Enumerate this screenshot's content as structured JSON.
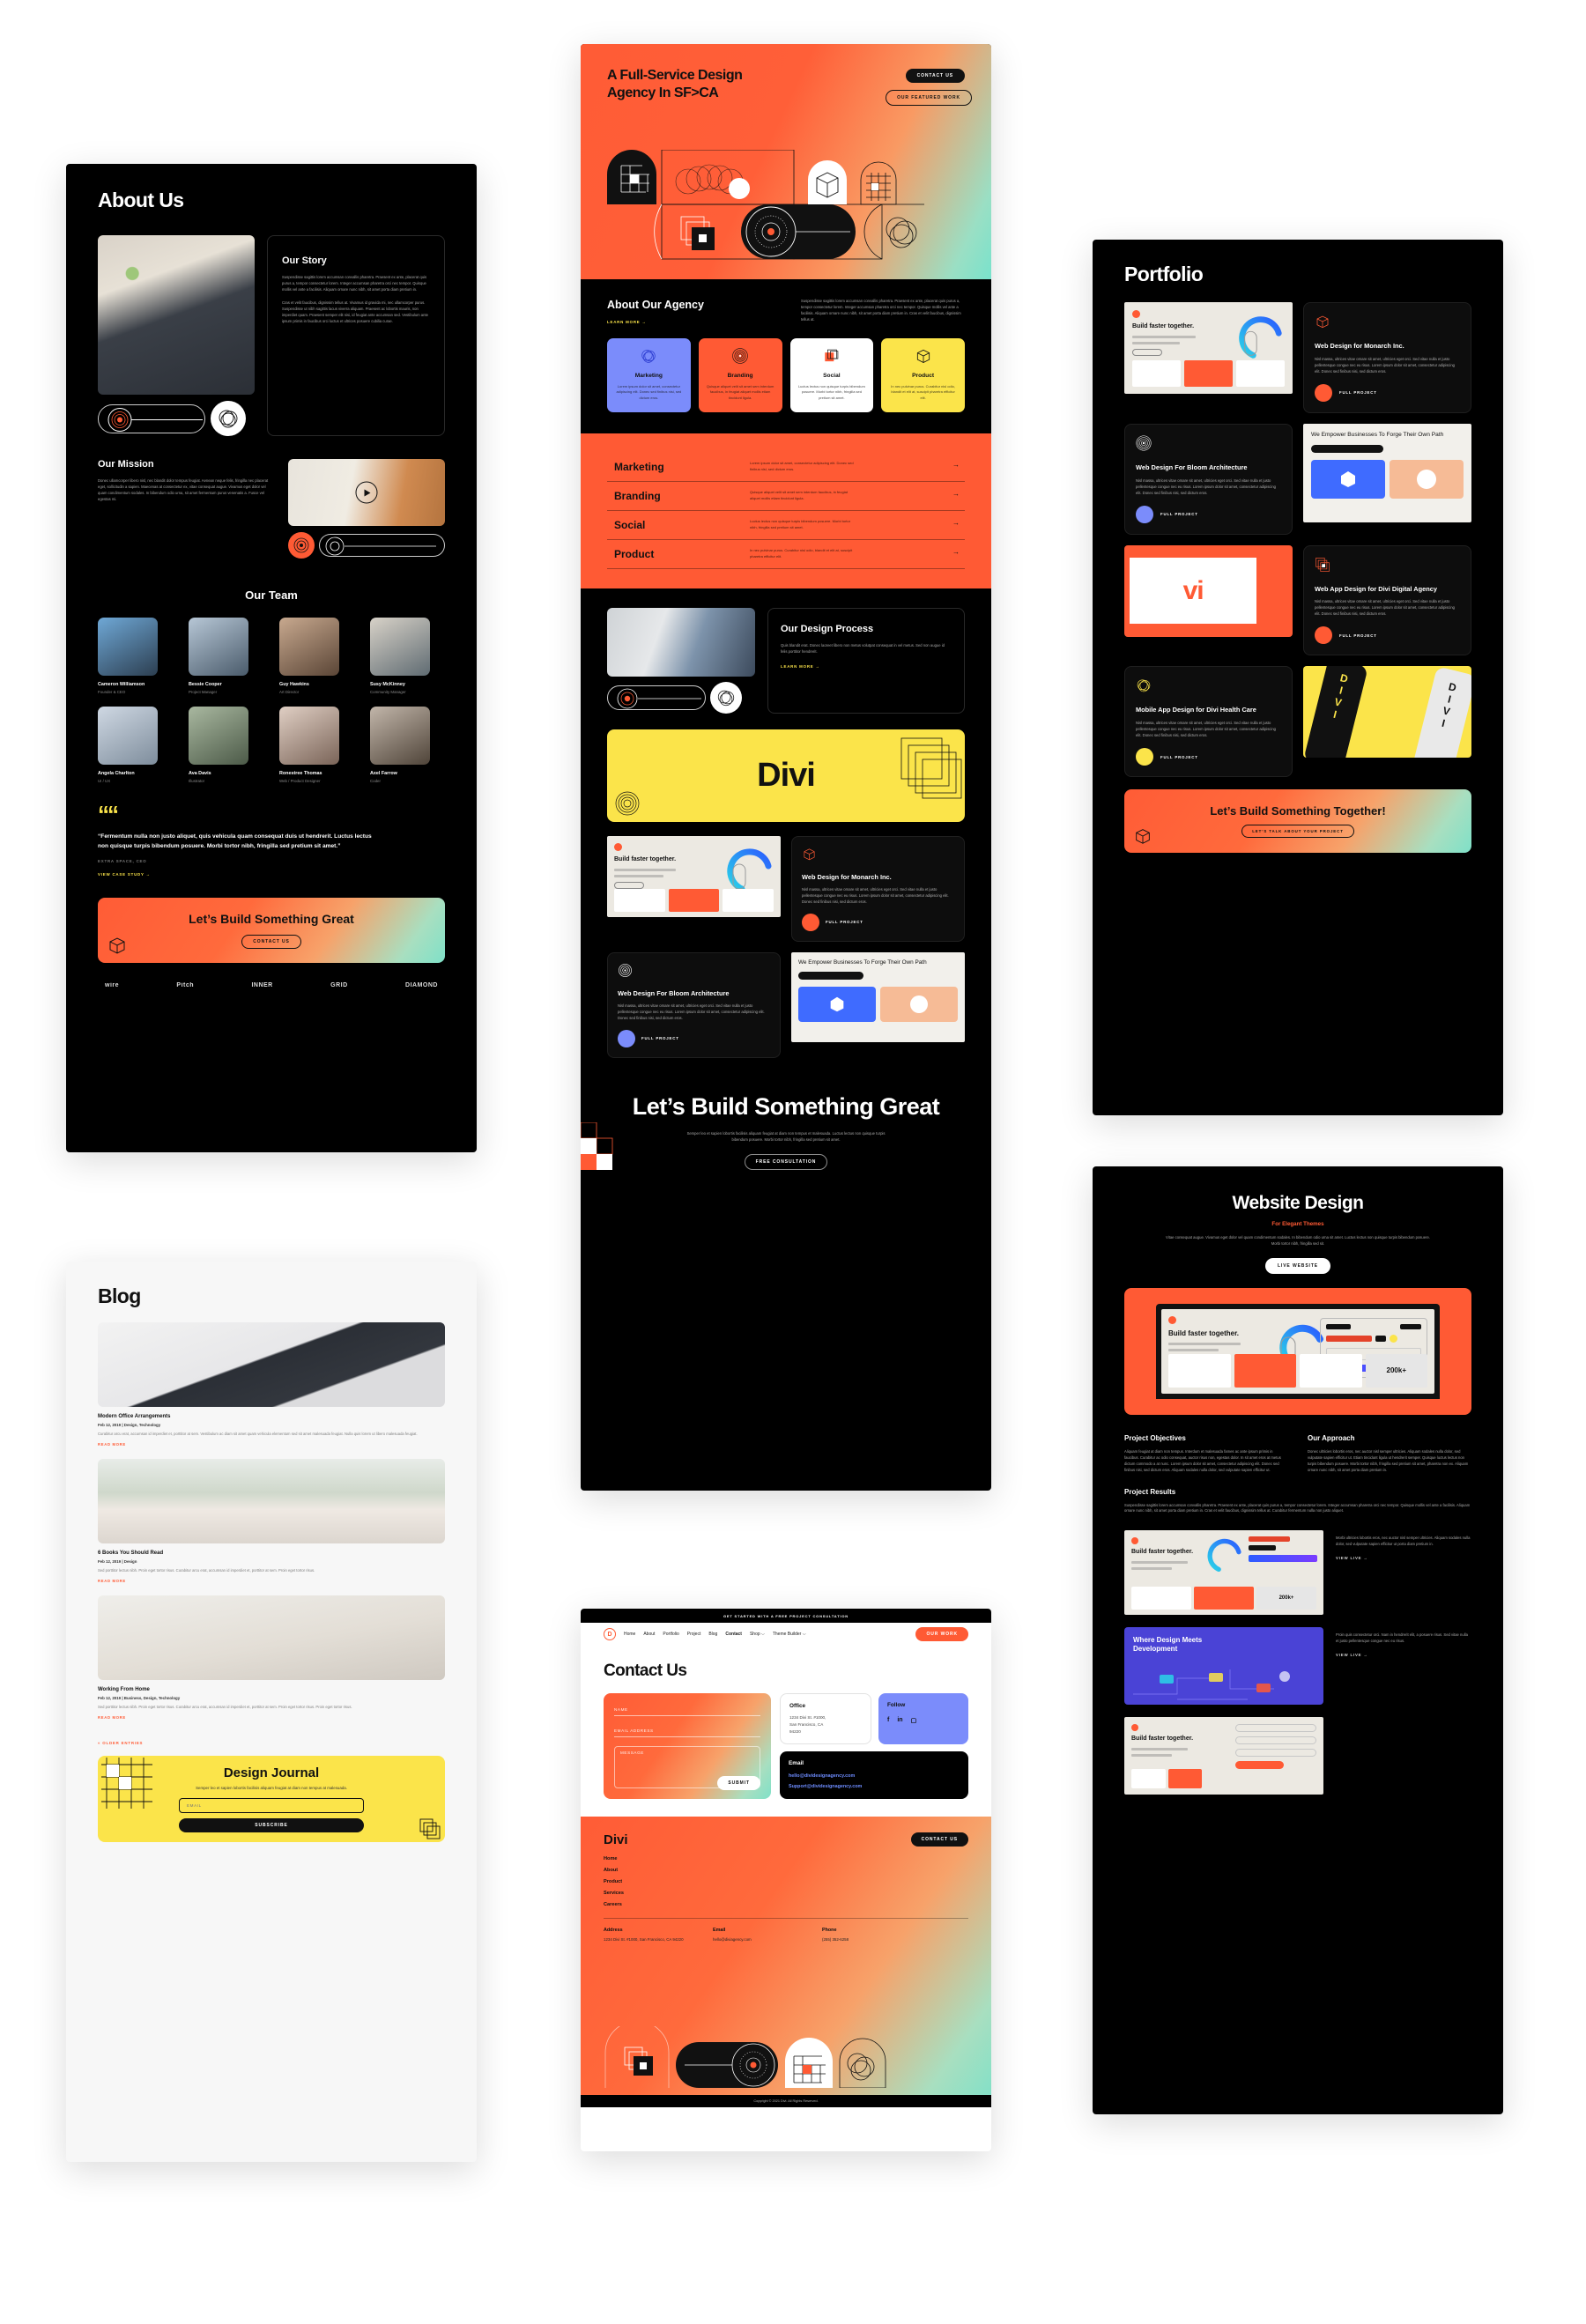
{
  "meta": {
    "accent_orange": "#ff5a34",
    "accent_yellow": "#fbe44a",
    "accent_blue": "#7b8cfb",
    "dark": "#000000"
  },
  "about": {
    "title": "About Us",
    "story": {
      "heading": "Our Story",
      "p1": "Suspendisse sagittis lorem accumsan convallis pharetra. Praesent ex ante, placerat quis purus a, tempor consectetur lorem. Integer accumsan pharetra orci nec tempor. Quisque mollis vel ante a facilisis. Aliquam ornare nunc nibh, sit amet porta diam pretium in.",
      "p2": "Cras et velit faucibus, dignissim tellus at. Vivamus id gravida mi, nec ullamcorper purus. Suspendisse ut nibh sagittis lacus viverra aliquam. Praesent ac lobortis mauris, non imperdiet quam. Praesent semper elit nisi, id feugiat ante accumsan sed. Vestibulum ante ipsum primis in faucibus orci luctus et ultrices posuere cubilia curae."
    },
    "mission": {
      "heading": "Our Mission",
      "body": "Donec ullamcorper libero nisl, nec blandit dolor tempus feugiat. Aenean neque felis, fringilla nec placerat eget, sollicitudin a sapien. Maecenas at consectetur ex, vitae consequat augue. Vivamus eget dolor vel quam condimentum sodales. In bibendum odio urna, sit amet fermentum purus venenatis a. Fusce vel egestas mi."
    },
    "team": {
      "heading": "Our Team",
      "members": [
        {
          "name": "Cameron Williamson",
          "role": "Founder & CEO"
        },
        {
          "name": "Bessie Cooper",
          "role": "Project Manager"
        },
        {
          "name": "Guy Hawkins",
          "role": "Art Director"
        },
        {
          "name": "Susy McKinney",
          "role": "Community Manager"
        },
        {
          "name": "Angela Charlton",
          "role": "UI / UX"
        },
        {
          "name": "Ava Davis",
          "role": "Illustrator"
        },
        {
          "name": "Ronestree Thomas",
          "role": "Web / Product Designer"
        },
        {
          "name": "Axel Farrow",
          "role": "Coder"
        }
      ]
    },
    "quote": {
      "mark": "““",
      "text": "“Fermentum nulla non justo aliquet, quis vehicula quam consequat duis ut hendrerit. Luctus lectus non quisque turpis bibendum posuere. Morbi tortor nibh, fringilla sed pretium sit amet.”",
      "attribution": "Extra Space, CEO",
      "link": "View Case Study →"
    },
    "cta": {
      "title": "Let’s Build Something Great",
      "button": "Contact Us"
    },
    "logos": [
      "wire",
      "Pitch",
      "INNER",
      "GRID",
      "DIAMOND"
    ]
  },
  "blog": {
    "title": "Blog",
    "posts": [
      {
        "title": "Modern Office Arrangements",
        "meta": "Feb 12, 2019 | Design, Technology",
        "excerpt": "Curabitur arcu erat, accumsan id imperdiet et, porttitor at sem. Vestibulum ac diam sit amet quam vehicula elementum sed sit amet malesuada feugiat. Nulla quis lorem ut libero malesuada feugiat.",
        "readmore": "Read More"
      },
      {
        "title": "6 Books You Should Read",
        "meta": "Feb 12, 2019 | Design",
        "excerpt": "Sed porttitor lectus nibh. Proin eget tortor risus. Curabitur arcu erat, accumsan id imperdiet et, porttitor at sem. Proin eget tortor risus.",
        "readmore": "Read More"
      },
      {
        "title": "Working From Home",
        "meta": "Feb 12, 2019 | Business, Design, Technology",
        "excerpt": "Sed porttitor lectus nibh. Proin eget tortor risus. Curabitur arcu erat, accumsan id imperdiet et, porttitor at sem. Proin eget tortor risus. Proin eget tortor risus.",
        "readmore": "Read More"
      }
    ],
    "older_entries": "« Older Entries",
    "newsletter": {
      "title": "Design Journal",
      "subtitle": "Semper leo et sapien lobortis facilisis aliquam feugiat at diam non tempus at malesuada.",
      "email_placeholder": "Email",
      "button": "Subscribe"
    }
  },
  "home": {
    "hero": {
      "title": "A Full-Service Design Agency In SF>CA",
      "btn_primary": "Contact Us",
      "btn_secondary": "Our Featured Work"
    },
    "about": {
      "heading": "About Our Agency",
      "link": "Learn More →",
      "body": "Suspendisse sagittis lorem accumsan convallis pharetra. Praesent ex ante, placerat quis purus a, tempor consectetur lorem. Integer accumsan pharetra orci nec tempor. Quisque mollis vel ante a facilisis. Aliquam ornare nunc nibh, sit amet porta diam pretium in. Cras et velit faucibus, dignissim tellus at.",
      "cards": [
        {
          "title": "Marketing",
          "text": "Lorem ipsum dolor sit amet, consectetur adipiscing elit. Donec sed finibus nisi, sed dictum eros.",
          "color": "#7b8cfb",
          "icon": "circles-icon"
        },
        {
          "title": "Branding",
          "text": "Quisque aliquet velit sit amet sem interdum faucibus, in feugiat aliquet mollis etiam tincidunt ligula.",
          "color": "#ff5a34",
          "icon": "radial-icon"
        },
        {
          "title": "Social",
          "text": "Luctus lectus non quisque turpis bibendum posuere. Morbi tortor nibh, fringilla sed pretium sit amet.",
          "color": "#ffffff",
          "icon": "squares-icon"
        },
        {
          "title": "Product",
          "text": "In nec pulvinar purus. Curabitur nisl odio, blandit et elit at, suscipit pharetra efficitur elit.",
          "color": "#fbe44a",
          "icon": "cube-icon"
        }
      ]
    },
    "services": [
      {
        "name": "Marketing",
        "text": "Lorem ipsum dolor sit amet, consectetur adipiscing elit. Donec sed finibus nisi, sed dictum eros."
      },
      {
        "name": "Branding",
        "text": "Quisque aliquet velit sit amet sem interdum faucibus, in feugiat aliquet mollis etiam tincidunt ligula."
      },
      {
        "name": "Social",
        "text": "Luctus lectus non quisque turpis bibendum posuere. Morbi tortor nibh, fringilla sed pretium sit amet."
      },
      {
        "name": "Product",
        "text": "In nec pulvinar purus. Curabitur nisl odio, blandit et elit at, suscipit pharetra efficitur elit."
      }
    ],
    "process": {
      "heading": "Our Design Process",
      "body": "Quis blandit erat. Donec laoreet libero non metus volutpat consequat in vel metus. Sed non augue id felis porttitor hendrerit.",
      "link": "Learn More →"
    },
    "divi_banner": "Divi",
    "featured": [
      {
        "title": "Web Design for Monarch Inc.",
        "text": "Nisl massa, ultrices vitae ornare sit amet, ultricies eget orci. Sed vitae nulla et justo pellentesque congue nec eu risus. Lorem ipsum dolor sit amet, consectetur adipiscing elit. Donec sed finibus nisi, sed dictum eros.",
        "cta": "Full Project",
        "dot": "#ff5a34"
      },
      {
        "title": "Web Design For Bloom Architecture",
        "text": "Nisl massa, ultrices vitae ornare sit amet, ultricies eget orci. Sed vitae nulla et justo pellentesque congue nec eu risus. Lorem ipsum dolor sit amet, consectetur adipiscing elit. Donec sed finibus nisi, sed dictum eros.",
        "cta": "Full Project",
        "dot": "#7b8cfb"
      }
    ],
    "mock_headline_1": "Build faster together.",
    "mock_headline_2": "We Empower Businesses To Forge Their Own Path",
    "final_cta": {
      "title": "Let’s Build Something Great",
      "body": "Semper leo et sapien lobortis facilisis aliquam feugiat at diam non tempus et malesuada. Luctus lectus non quisque turpis bibendum posuere. Morbi tortor nibh, fringilla sed pretium sit amet.",
      "button": "Free Consultation"
    }
  },
  "contact": {
    "topbar": "Get Started With A Free Project Consultation",
    "logo": "D",
    "nav": [
      "Home",
      "About",
      "Portfolio",
      "Project",
      "Blog",
      "Contact",
      "Shop ⌵",
      "Theme Builder ⌵"
    ],
    "nav_active": "Contact",
    "nav_button": "Our Work",
    "title": "Contact Us",
    "form": {
      "name_placeholder": "Name",
      "email_placeholder": "Email Address",
      "message_placeholder": "Message",
      "submit": "Submit"
    },
    "office": {
      "label": "Office",
      "lines": [
        "1234 Divi St. #1000,",
        "San Francisco, CA",
        "94220"
      ]
    },
    "follow": {
      "label": "Follow",
      "icons": [
        "facebook-icon",
        "linkedin-icon",
        "instagram-icon"
      ]
    },
    "email": {
      "label": "Email",
      "addresses": [
        "hello@dividesignagency.com",
        "Support@dividesignagency.com"
      ]
    },
    "footer": {
      "brand": "Divi",
      "button": "Contact Us",
      "links": [
        "Home",
        "About",
        "Product",
        "Services",
        "Careers"
      ],
      "address": {
        "label": "Address",
        "value": "1234 Divi St. #1000, San Francisco, CA 94220"
      },
      "email": {
        "label": "Email",
        "value": "hello@diviagency.com"
      },
      "phone": {
        "label": "Phone",
        "value": "(255) 352-6258"
      },
      "copyright": "Copyright © 2021 Divi. All Rights Reserved."
    }
  },
  "portfolio": {
    "title": "Portfolio",
    "projects": [
      {
        "title": "Web Design for Monarch Inc.",
        "text": "Nisl massa, ultrices vitae ornare sit amet, ultricies eget orci. Sed vitae nulla et justo pellentesque congue nec eu risus. Lorem ipsum dolor sit amet, consectetur adipiscing elit. Donec sed finibus nisi, sed dictum eros.",
        "cta": "Full Project",
        "dot": "#ff5a34",
        "icon": "cube-icon"
      },
      {
        "title": "Web Design For Bloom Architecture",
        "text": "Nisl massa, ultrices vitae ornare sit amet, ultricies eget orci. Sed vitae nulla et justo pellentesque congue nec eu risus. Lorem ipsum dolor sit amet, consectetur adipiscing elit. Donec sed finibus nisi, sed dictum eros.",
        "cta": "Full Project",
        "dot": "#7b8cfb",
        "icon": "radial-icon"
      },
      {
        "title": "Web App Design for Divi Digital Agency",
        "text": "Nisl massa, ultrices vitae ornare sit amet, ultricies eget orci. Sed vitae nulla et justo pellentesque congue nec eu risus. Lorem ipsum dolor sit amet, consectetur adipiscing elit. Donec sed finibus nisi, sed dictum eros.",
        "cta": "Full Project",
        "dot": "#ff5a34",
        "icon": "squares-icon"
      },
      {
        "title": "Mobile App Design for Divi Health Care",
        "text": "Nisl massa, ultrices vitae ornare sit amet, ultricies eget orci. Sed vitae nulla et justo pellentesque congue nec eu risus. Lorem ipsum dolor sit amet, consectetur adipiscing elit. Donec sed finibus nisi, sed dictum eros.",
        "cta": "Full Project",
        "dot": "#fbe44a",
        "icon": "circles-icon"
      }
    ],
    "mock_headline_1": "Build faster together.",
    "mock_headline_2": "We Empower Businesses To Forge Their Own Path",
    "mock_wordmark": "vi",
    "mock_divi": "DIVI",
    "cta": {
      "title": "Let’s Build Something Together!",
      "button": "Let’s Talk About Your Project"
    }
  },
  "website": {
    "title": "Website Design",
    "subtitle": "For Elegant Themes",
    "body": "Vitae consequat augue. Vivamus eget dolor vel quam condimentum sodales. In bibendum odio urna sit amet. Luctus lectus non quisque turpis bibendum posuere. Morbi tortor nibh, fringilla sed sit.",
    "button": "Live Website",
    "objectives": {
      "heading": "Project Objectives",
      "text": "Aliquam feugiat at diam non tempus. Interdum et malesuada fames ac ante ipsum primis in faucibus. Curabitur ac odio consequat, auctor risus non, egestas dolor. In sit amet eros at metus dictum commodo a at nunc. Lorem ipsum dolor sit amet, consectetur adipiscing elit. Donec sed finibus nisi, sed dictum eros. Aliquam sodales nulla dolor, sed vulputate sapien efficitur ut."
    },
    "approach": {
      "heading": "Our Approach",
      "text": "Donec ultricies lobortis eros, nec auctor nisl semper ultricies. Aliquam sodales nulla dolor, sed vulputate sapien efficitur ut. Etiam tincidunt ligula ut hendrerit semper. Quisque luctus lectus non turpis bibendum posuere. Morbi tortor nibh, fringilla sed pretium sit amet, pharetra non ex. Aliquam ornare nunc nibh, sit amet porta diam pretium in."
    },
    "results": {
      "heading": "Project Results",
      "text": "Suspendisse sagittis lorem accumsan convallis pharetra. Praesent ex ante, placerat quis purus a, tempor consectetur lorem. Integer accumsan pharetra orci nec tempor. Quisque mollis vel ante a facilisis. Aliquam ornare nunc nibh, sit amet porta diam pretium in. Cras et velit faucibus, dignissim tellus at. Curabitur fermentum nulla non justo aliquet."
    },
    "showcase": [
      {
        "headline": "Build faster together.",
        "note": "Morbi ultricies lobortis eros, nec auctor nisl semper ultricies. Aliquam sodales nulla dolor, sed vulputate sapien efficitur ut porta diam pretium in.",
        "link": "View Live →",
        "stat": "200k+"
      },
      {
        "headline": "Where Design Meets Development",
        "note": "Proin quis consectetur orci. Nam in hendrerit elit, a posuere risus. Sed vitae nulla et justo pellentesque congue nec eu risus.",
        "link": "View Live →"
      },
      {
        "headline": "Build faster together.",
        "note": "",
        "link": ""
      }
    ]
  }
}
